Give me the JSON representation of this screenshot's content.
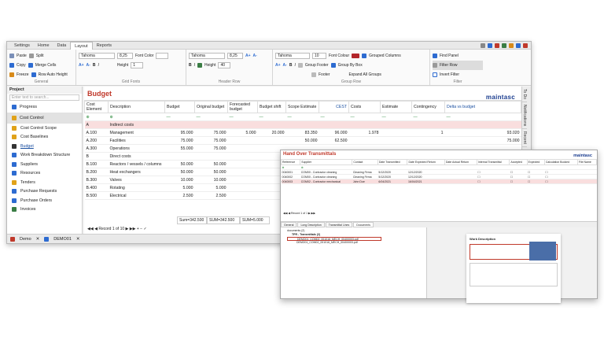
{
  "menu": {
    "tabs": [
      "Settings",
      "Home",
      "Data",
      "Layout",
      "Reports"
    ],
    "active": "Layout"
  },
  "ribbon": {
    "general": {
      "label": "General",
      "items": [
        "Paste",
        "Copy",
        "Freeze",
        "Split",
        "Merge Cells",
        "Row Auto Height"
      ]
    },
    "grid_fonts": {
      "label": "Grid Fonts",
      "font": "Tahoma",
      "size": "8,25",
      "font_colour_label": "Font Color",
      "height_label": "Height",
      "height_value": "1"
    },
    "header_rows": {
      "label": "Header Row",
      "font": "Tahoma",
      "size": "8,25",
      "height_label": "Height",
      "height_value": "40"
    },
    "group_rows": {
      "label": "Group Row",
      "font": "Tahoma",
      "size": "10",
      "font_colour_label": "Font Colour",
      "group_footer": "Group Footer",
      "footer": "Footer",
      "grouped_columns": "Grouped Columns",
      "group_by_box": "Group By Box",
      "expand_all": "Expand All Groups"
    },
    "filter": {
      "label": "Filter",
      "find_panel": "Find Panel",
      "filter_row": "Filter Row",
      "invert_filter": "Invert Filter"
    }
  },
  "project_panel": {
    "title": "Project",
    "search_placeholder": "Enter text to search...",
    "sections": [
      "Progress",
      "Cost Control"
    ],
    "items": [
      "Cost Control Scope",
      "Cost Baselines",
      "Budget",
      "Work Breakdown Structure",
      "Suppliers",
      "Resources",
      "Tenders",
      "Purchase Requests",
      "Purchase Orders",
      "Invoices"
    ],
    "active_item": "Budget"
  },
  "bottom_tabs": [
    "Demo",
    "DEMO01"
  ],
  "budget": {
    "title": "Budget",
    "logo": "maintasc",
    "columns": [
      "Cost Element",
      "Description",
      "Budget",
      "Original budget",
      "Forecasted budget",
      "Budget shift",
      "Scope Estimate",
      "CEST",
      "Costs",
      "Estimate",
      "Contingency",
      "Delta vs budget"
    ],
    "rows": [
      [
        "A",
        "Indirect costs",
        "",
        "",
        "",
        "",
        "",
        "",
        "",
        "",
        "",
        ""
      ],
      [
        "A.100",
        "Management",
        "95.000",
        "75.000",
        "5.000",
        "20.000",
        "83.350",
        "96.000",
        "1.978",
        "",
        "1",
        "93.020"
      ],
      [
        "A.200",
        "Facilities",
        "75.000",
        "75.000",
        "",
        "",
        "50.000",
        "62.500",
        "",
        "",
        "",
        "75.000"
      ],
      [
        "A.300",
        "Operations",
        "55.000",
        "75.000",
        "",
        "",
        "",
        "",
        "",
        "",
        "",
        ""
      ],
      [
        "B",
        "Direct costs",
        "",
        "",
        "",
        "",
        "",
        "",
        "",
        "",
        "",
        ""
      ],
      [
        "B.100",
        "Reactors / vessels / columns",
        "50.000",
        "50.000",
        "",
        "",
        "",
        "",
        "",
        "",
        "",
        ""
      ],
      [
        "B.200",
        "Heat exchangers",
        "50.000",
        "50.000",
        "",
        "",
        "",
        "",
        "",
        "",
        "",
        ""
      ],
      [
        "B.300",
        "Valves",
        "10.000",
        "10.000",
        "",
        "",
        "",
        "",
        "",
        "",
        "",
        ""
      ],
      [
        "B.400",
        "Rotating",
        "5.000",
        "5.000",
        "",
        "",
        "",
        "",
        "",
        "",
        "",
        ""
      ],
      [
        "B.500",
        "Electrical",
        "2.500",
        "2.500",
        "",
        "",
        "",
        "",
        "",
        "",
        "",
        ""
      ]
    ],
    "sums": [
      "Sum=342.500",
      "SUM=342.500",
      "SUM=5.000"
    ],
    "pager": "Record 1 of 10"
  },
  "right_sidebar": [
    "To Do",
    "Notifications",
    "Recent"
  ],
  "dialog": {
    "title": "Hand Over Transmittals",
    "logo": "maintasc",
    "columns": [
      "Reference",
      "Supplier",
      "Contact",
      "Date Transmitted",
      "Date Expected Return",
      "Date Actual Return",
      "Internal Transmittal",
      "Accepted",
      "Expected",
      "Calculation Booked",
      "File Name"
    ],
    "rows": [
      [
        "0040001",
        "COM00 - Contractor cleaning",
        "Cleaning Firma",
        "5/12/2020",
        "12/12/2020"
      ],
      [
        "0040002",
        "COM00 - Contractor cleaning",
        "Cleaning Firma",
        "5/12/2020",
        "12/12/2020"
      ],
      [
        "0040003",
        "COM02 - Contractor mechanical",
        "John Doe",
        "6/04/2021",
        "16/04/2021"
      ]
    ],
    "tabs": [
      "General",
      "Long Description",
      "Transmittal Lines",
      "Documents"
    ],
    "active_tab": "Documents",
    "pager": "Record 1 of 1",
    "tree": [
      "documents (2)",
      "TPR - Transmittals (2)",
      "DEMO01_COM02_001016_MECH_00400003.pdf",
      "DEMO01_COM02_001016_MECH_00400003.pdf"
    ],
    "preview_title": "Work Description"
  }
}
